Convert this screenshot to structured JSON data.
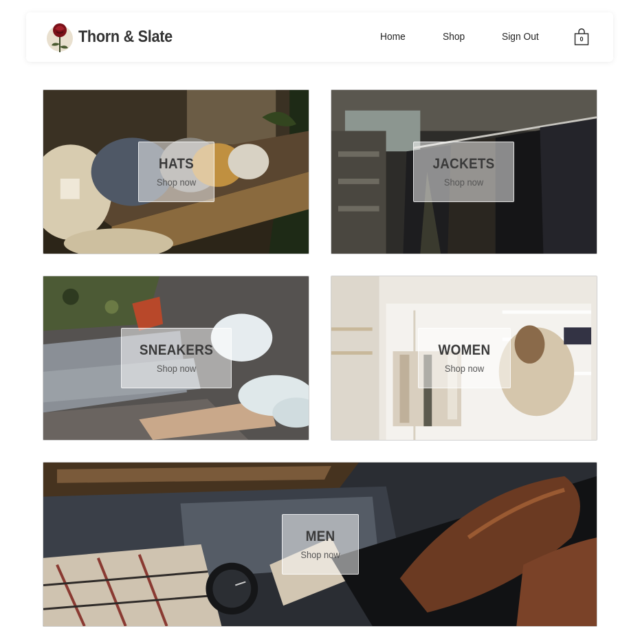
{
  "header": {
    "brand": "Thorn & Slate",
    "nav": {
      "home": "Home",
      "shop": "Shop",
      "sign_out": "Sign Out"
    },
    "cart_count": "0"
  },
  "categories": [
    {
      "title": "HATS",
      "subtitle": "Shop now"
    },
    {
      "title": "JACKETS",
      "subtitle": "Shop now"
    },
    {
      "title": "SNEAKERS",
      "subtitle": "Shop now"
    },
    {
      "title": "WOMEN",
      "subtitle": "Shop now"
    },
    {
      "title": "MEN",
      "subtitle": "Shop now"
    }
  ],
  "icons": {
    "logo": "rose-logo-icon",
    "cart": "shopping-bag-icon"
  }
}
